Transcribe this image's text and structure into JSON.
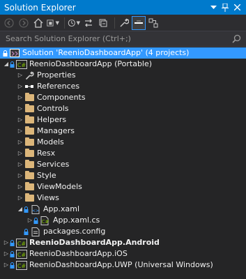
{
  "window": {
    "title": "Solution Explorer"
  },
  "search": {
    "placeholder": "Search Solution Explorer (Ctrl+;)"
  },
  "tree": {
    "solution": "Solution 'ReenioDashboardApp' (4 projects)",
    "portable_project": "ReenioDashboardApp (Portable)",
    "properties": "Properties",
    "references": "References",
    "components": "Components",
    "controls": "Controls",
    "helpers": "Helpers",
    "managers": "Managers",
    "models": "Models",
    "resx": "Resx",
    "services": "Services",
    "style": "Style",
    "viewmodels": "ViewModels",
    "views": "Views",
    "app_xaml": "App.xaml",
    "app_xaml_cs": "App.xaml.cs",
    "packages_config": "packages.config",
    "android_project": "ReenioDashboardApp.Android",
    "ios_project": "ReenioDashboardApp.iOS",
    "uwp_project": "ReenioDashboardApp.UWP (Universal Windows)"
  },
  "colors": {
    "title_bar": "#007acc",
    "background": "#252526",
    "selection": "#3399ff",
    "folder": "#dcb67a"
  }
}
